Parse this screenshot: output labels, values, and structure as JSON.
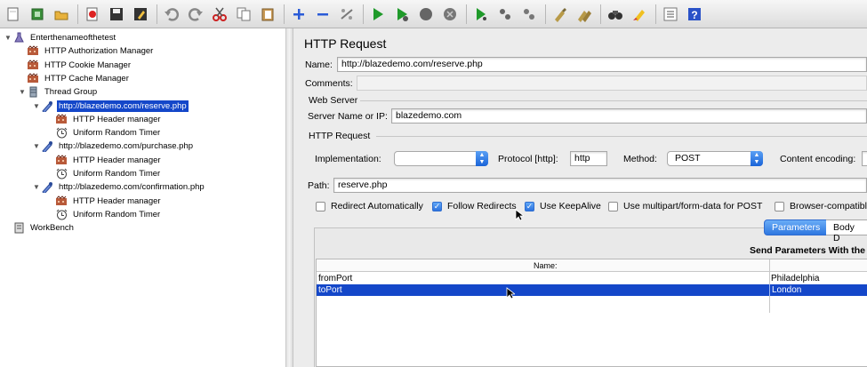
{
  "toolbar": {
    "buttons": [
      "new-icon",
      "templates-icon",
      "open-icon",
      "close-icon",
      "save-icon",
      "save-as-icon",
      "undo-icon",
      "redo-icon",
      "cut-icon",
      "copy-icon",
      "paste-icon",
      "expand-icon",
      "collapse-icon",
      "toggle-icon",
      "start-icon",
      "start-no-timers-icon",
      "stop-icon",
      "shutdown-icon",
      "remote-start-icon",
      "remote-stop-icon",
      "remote-shutdown-icon",
      "clear-icon",
      "clear-all-icon",
      "search-icon",
      "reset-search-icon",
      "function-helper-icon",
      "help-icon"
    ]
  },
  "tree": {
    "items": [
      {
        "label": "Enterthenameofthetest",
        "icon": "test-plan-icon",
        "twisty": "▼"
      },
      {
        "label": "HTTP Authorization Manager",
        "icon": "config-element-icon",
        "twisty": ""
      },
      {
        "label": "HTTP Cookie Manager",
        "icon": "config-element-icon",
        "twisty": ""
      },
      {
        "label": "HTTP Cache Manager",
        "icon": "config-element-icon",
        "twisty": ""
      },
      {
        "label": "Thread Group",
        "icon": "thread-group-icon",
        "twisty": "▼"
      },
      {
        "label": "http://blazedemo.com/reserve.php",
        "icon": "sampler-icon",
        "twisty": "▼",
        "selected": true
      },
      {
        "label": "HTTP Header manager",
        "icon": "config-element-icon",
        "twisty": ""
      },
      {
        "label": "Uniform Random Timer",
        "icon": "timer-icon",
        "twisty": ""
      },
      {
        "label": "http://blazedemo.com/purchase.php",
        "icon": "sampler-icon",
        "twisty": "▼"
      },
      {
        "label": "HTTP Header manager",
        "icon": "config-element-icon",
        "twisty": ""
      },
      {
        "label": "Uniform Random Timer",
        "icon": "timer-icon",
        "twisty": ""
      },
      {
        "label": "http://blazedemo.com/confirmation.php",
        "icon": "sampler-icon",
        "twisty": "▼"
      },
      {
        "label": "HTTP Header manager",
        "icon": "config-element-icon",
        "twisty": ""
      },
      {
        "label": "Uniform Random Timer",
        "icon": "timer-icon",
        "twisty": ""
      },
      {
        "label": "WorkBench",
        "icon": "workbench-icon",
        "twisty": ""
      }
    ]
  },
  "panel": {
    "title": "HTTP Request",
    "name_label": "Name:",
    "name_value": "http://blazedemo.com/reserve.php",
    "comments_label": "Comments:",
    "comments_value": "",
    "web_server_label": "Web Server",
    "server_label": "Server Name or IP:",
    "server_value": "blazedemo.com",
    "http_request_label": "HTTP Request",
    "implementation_label": "Implementation:",
    "implementation_value": "",
    "protocol_label": "Protocol [http]:",
    "protocol_value": "http",
    "method_label": "Method:",
    "method_value": "POST",
    "content_encoding_label": "Content encoding:",
    "path_label": "Path:",
    "path_value": "reserve.php",
    "checkboxes": [
      {
        "label": "Redirect Automatically",
        "checked": false
      },
      {
        "label": "Follow Redirects",
        "checked": true
      },
      {
        "label": "Use KeepAlive",
        "checked": true
      },
      {
        "label": "Use multipart/form-data for POST",
        "checked": false
      },
      {
        "label": "Browser-compatibl",
        "checked": false
      }
    ],
    "tabs": {
      "parameters": "Parameters",
      "body": "Body D"
    },
    "send_params_label": "Send Parameters With the R",
    "grid": {
      "name_header": "Name:",
      "rows": [
        {
          "name": "fromPort",
          "value": "Philadelphia",
          "selected": false
        },
        {
          "name": "toPort",
          "value": "London",
          "selected": true
        }
      ]
    }
  },
  "colors": {
    "selection": "#1447c9",
    "accent": "#2e77e0"
  }
}
